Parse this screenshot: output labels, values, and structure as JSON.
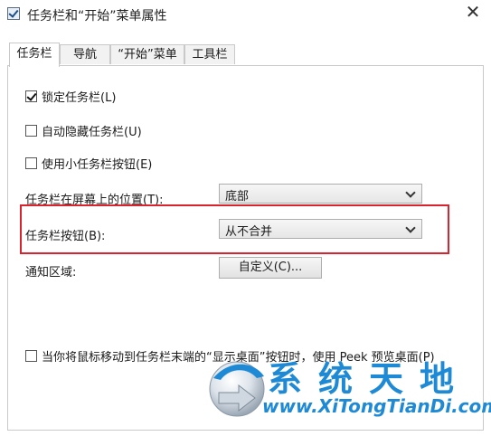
{
  "window": {
    "title": "任务栏和“开始”菜单属性",
    "close_glyph": "✕"
  },
  "tabs": [
    {
      "label": "任务栏",
      "active": true
    },
    {
      "label": "导航",
      "active": false
    },
    {
      "label": "“开始”菜单",
      "active": false
    },
    {
      "label": "工具栏",
      "active": false
    }
  ],
  "options": {
    "lock_taskbar": {
      "label": "锁定任务栏(L)",
      "checked": true
    },
    "auto_hide": {
      "label": "自动隐藏任务栏(U)",
      "checked": false
    },
    "small_buttons": {
      "label": "使用小任务栏按钮(E)",
      "checked": false
    },
    "peek": {
      "label": "当你将鼠标移动到任务栏末端的“显示桌面”按钮时，使用 Peek 预览桌面(P)",
      "checked": false
    }
  },
  "location": {
    "label": "任务栏在屏幕上的位置(T):",
    "value": "底部"
  },
  "buttons_combine": {
    "label": "任务栏按钮(B):",
    "value": "从不合并"
  },
  "notification": {
    "label": "通知区域:",
    "button_label": "自定义(C)..."
  },
  "watermark": {
    "title": "系统天地",
    "url": "www.XiTongTianDi.com"
  },
  "colors": {
    "highlight": "#d9232e",
    "watermark": "#1e8ad6"
  }
}
